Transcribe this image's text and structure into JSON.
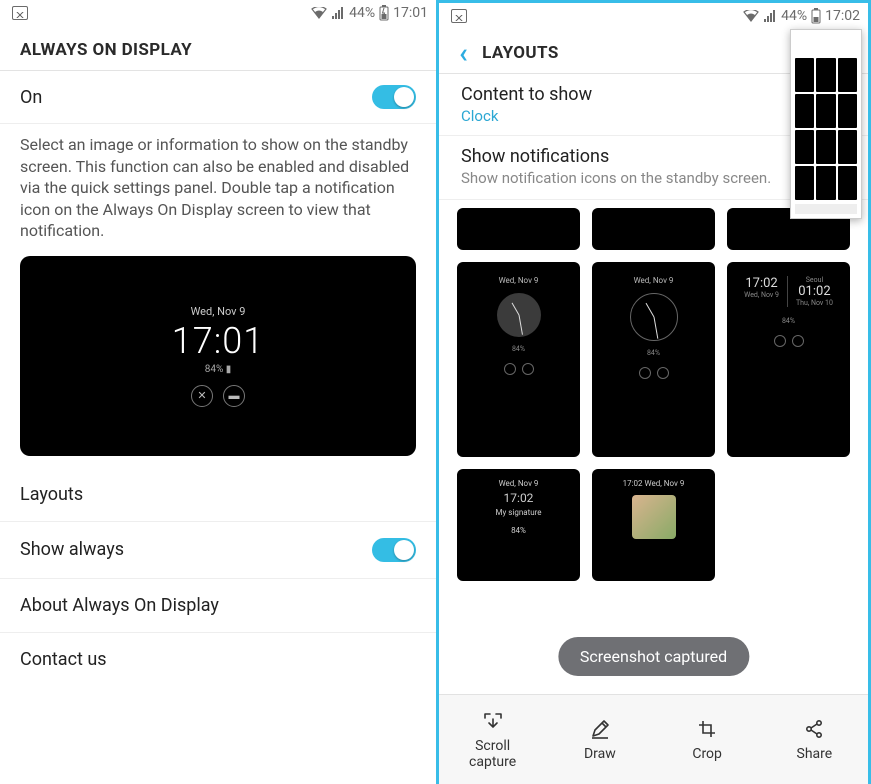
{
  "left": {
    "status": {
      "battery_pct": "44%",
      "time": "17:01"
    },
    "title": "ALWAYS ON DISPLAY",
    "on_label": "On",
    "description": "Select an image or information to show on the standby screen. This function can also be enabled and disabled via the quick settings panel. Double tap a notification icon on the Always On Display screen to view that notification.",
    "preview": {
      "date": "Wed, Nov 9",
      "time": "17:01",
      "battery": "84%"
    },
    "menu": {
      "layouts": "Layouts",
      "show_always": "Show always",
      "about": "About Always On Display",
      "contact": "Contact us"
    }
  },
  "right": {
    "status": {
      "battery_pct": "44%",
      "time": "17:02"
    },
    "title": "LAYOUTS",
    "content_to_show": {
      "label": "Content to show",
      "value": "Clock"
    },
    "show_notifications": {
      "label": "Show notifications",
      "desc": "Show notification icons on the standby screen."
    },
    "tiles": {
      "date": "Wed, Nov 9",
      "dual_left_time": "17:02",
      "dual_right_time": "01:02",
      "dual_right_city": "Seoul",
      "dual_right_date": "Thu, Nov 10",
      "sig_time": "17:02",
      "sig_date": "Wed, Nov 9",
      "sig_text": "My signature",
      "photo_time": "17:02",
      "photo_date": "Wed, Nov 9",
      "batt": "84%"
    },
    "toast": "Screenshot captured",
    "toolbar": {
      "scroll": "Scroll capture",
      "draw": "Draw",
      "crop": "Crop",
      "share": "Share"
    }
  }
}
